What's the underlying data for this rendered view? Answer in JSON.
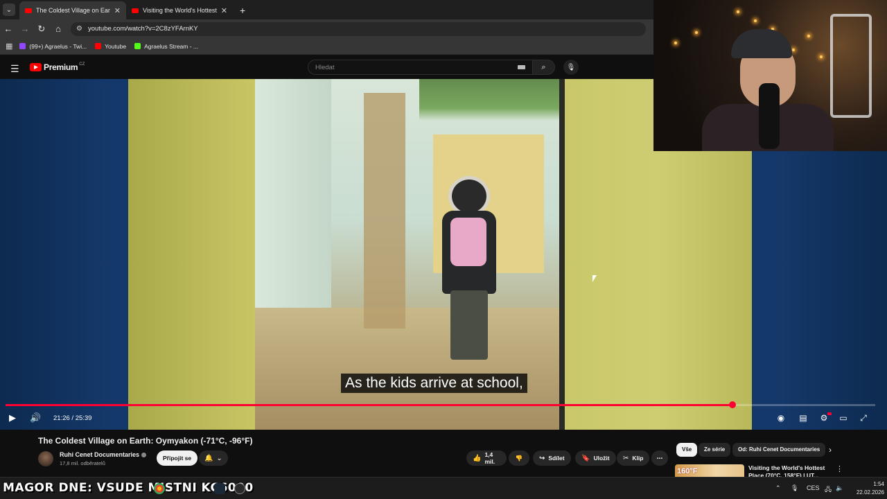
{
  "browser": {
    "tabs": [
      {
        "title": "The Coldest Village on Earth: O",
        "active": true
      },
      {
        "title": "Visiting the World's Hottest Pla",
        "active": false
      }
    ],
    "url": "youtube.com/watch?v=2C8zYFArnKY",
    "bookmarks": [
      {
        "label": "(99+) Agraelus - Twi...",
        "icon": "twitch-icon",
        "color": "#9146ff"
      },
      {
        "label": "Youtube",
        "icon": "youtube-icon",
        "color": "#ff0000"
      },
      {
        "label": "Agraelus Stream - ...",
        "icon": "kick-icon",
        "color": "#53fc18"
      }
    ]
  },
  "youtube": {
    "logo_word": "Premium",
    "country": "CZ",
    "search_placeholder": "Hledat"
  },
  "player": {
    "subtitle": "As the kids arrive at school,",
    "time_display": "21:26 / 25:39",
    "progress_fraction": 0.836,
    "accent": "#ff0033"
  },
  "video": {
    "title": "The Coldest Village on Earth: Oymyakon (-71°C, -96°F)",
    "channel": "Ruhi Cenet Documentaries",
    "subscribers": "17,8 mil. odběratelů",
    "join_label": "Připojit se",
    "likes": "1,4 mil.",
    "share_label": "Sdílet",
    "save_label": "Uložit",
    "clip_label": "Klip"
  },
  "sidebar": {
    "chips": [
      "Vše",
      "Ze série",
      "Od: Ruhi Cenet Documentaries"
    ],
    "rec_title": "Visiting the World's Hottest Place (70°C, 158°F) | UT...",
    "rec_thumb_text": "160°F"
  },
  "taskbar": {
    "ticker": "MAGOR DNE: VSUDE   MISTNI KC6000",
    "lang": "CES",
    "time": "1:54",
    "date": "22.02.2026"
  }
}
